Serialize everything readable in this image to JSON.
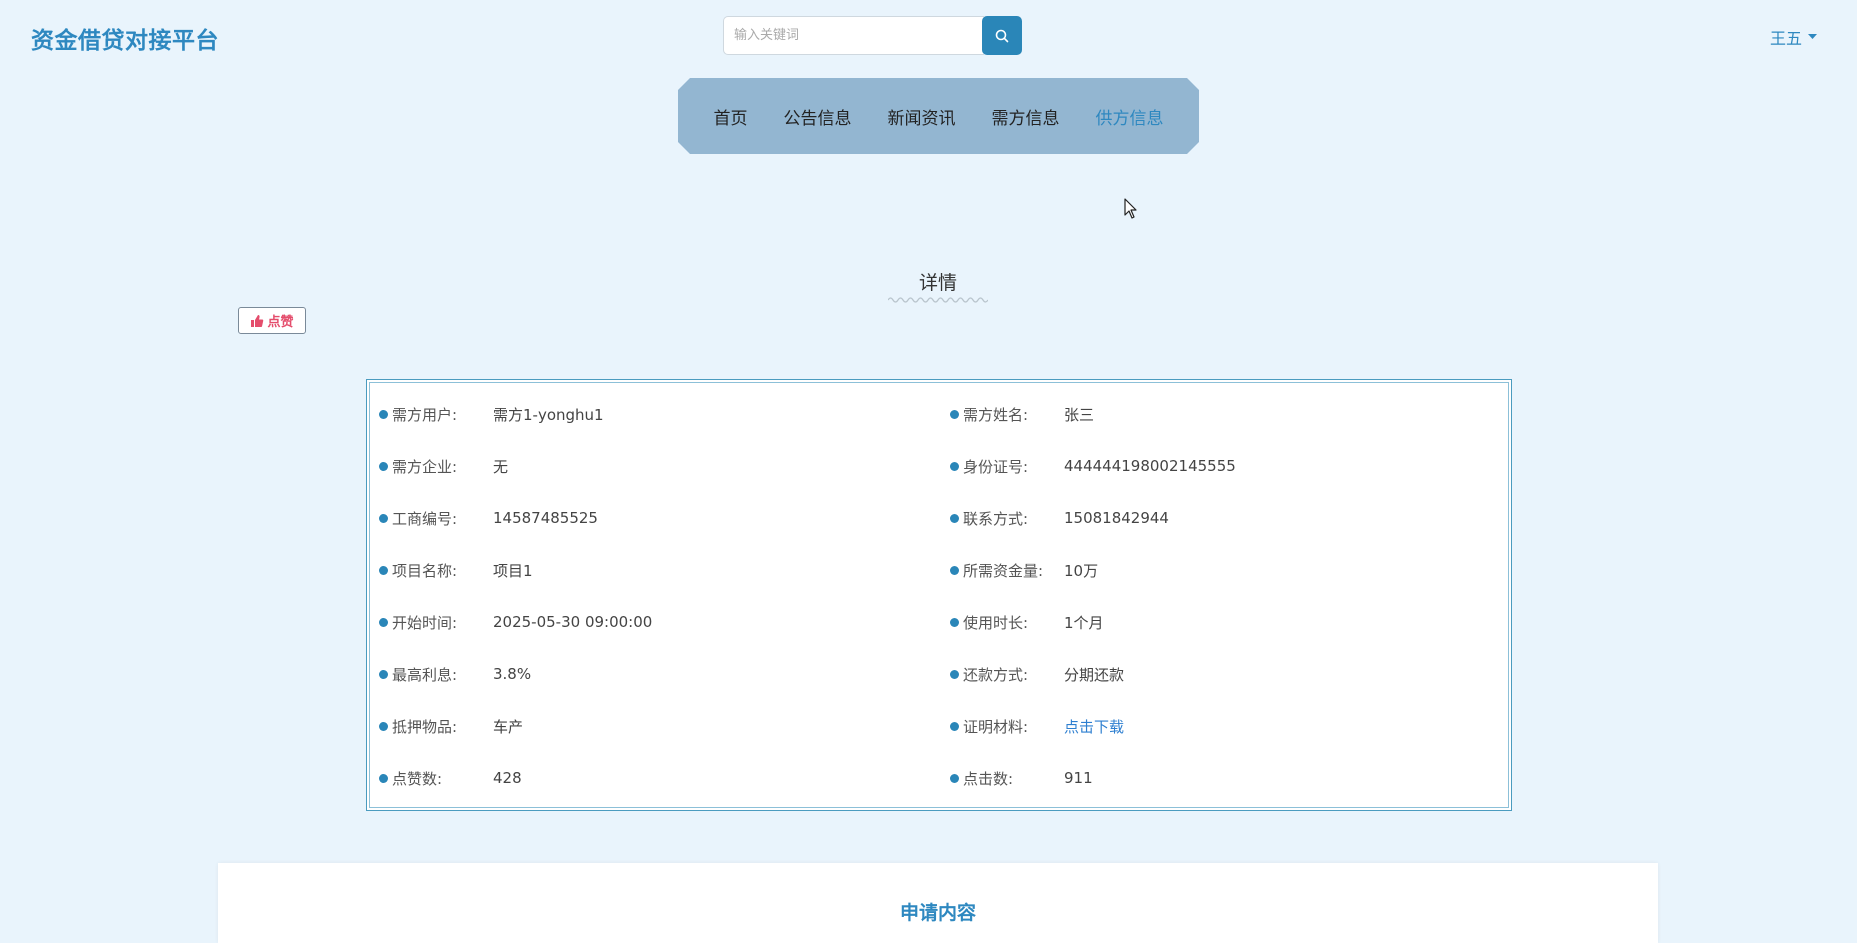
{
  "header": {
    "logo": "资金借贷对接平台",
    "search_placeholder": "输入关键词",
    "user_name": "王五"
  },
  "nav": {
    "items": [
      {
        "label": "首页"
      },
      {
        "label": "公告信息"
      },
      {
        "label": "新闻资讯"
      },
      {
        "label": "需方信息"
      },
      {
        "label": "供方信息"
      }
    ],
    "active": "供方信息"
  },
  "main": {
    "title": "详情",
    "like_label": "点赞"
  },
  "details": [
    {
      "left": {
        "label": "需方用户:",
        "value": "需方1-yonghu1"
      },
      "right": {
        "label": "需方姓名:",
        "value": "张三"
      }
    },
    {
      "left": {
        "label": "需方企业:",
        "value": "无"
      },
      "right": {
        "label": "身份证号:",
        "value": "444444198002145555"
      }
    },
    {
      "left": {
        "label": "工商编号:",
        "value": "14587485525"
      },
      "right": {
        "label": "联系方式:",
        "value": "15081842944"
      }
    },
    {
      "left": {
        "label": "项目名称:",
        "value": "项目1"
      },
      "right": {
        "label": "所需资金量:",
        "value": "10万"
      }
    },
    {
      "left": {
        "label": "开始时间:",
        "value": "2025-05-30 09:00:00"
      },
      "right": {
        "label": "使用时长:",
        "value": "1个月"
      }
    },
    {
      "left": {
        "label": "最高利息:",
        "value": "3.8%"
      },
      "right": {
        "label": "还款方式:",
        "value": "分期还款"
      }
    },
    {
      "left": {
        "label": "抵押物品:",
        "value": "车产"
      },
      "right": {
        "label": "证明材料:",
        "value": "点击下载"
      }
    },
    {
      "left": {
        "label": "点赞数:",
        "value": "428"
      },
      "right": {
        "label": "点击数:",
        "value": "911"
      }
    }
  ],
  "apply": {
    "title": "申请内容"
  },
  "colors": {
    "background": "#e9f4fc",
    "accent": "#2e88c0",
    "nav_bg": "#93b6d1",
    "link": "#2e7fd0",
    "like": "#e44d6c"
  }
}
